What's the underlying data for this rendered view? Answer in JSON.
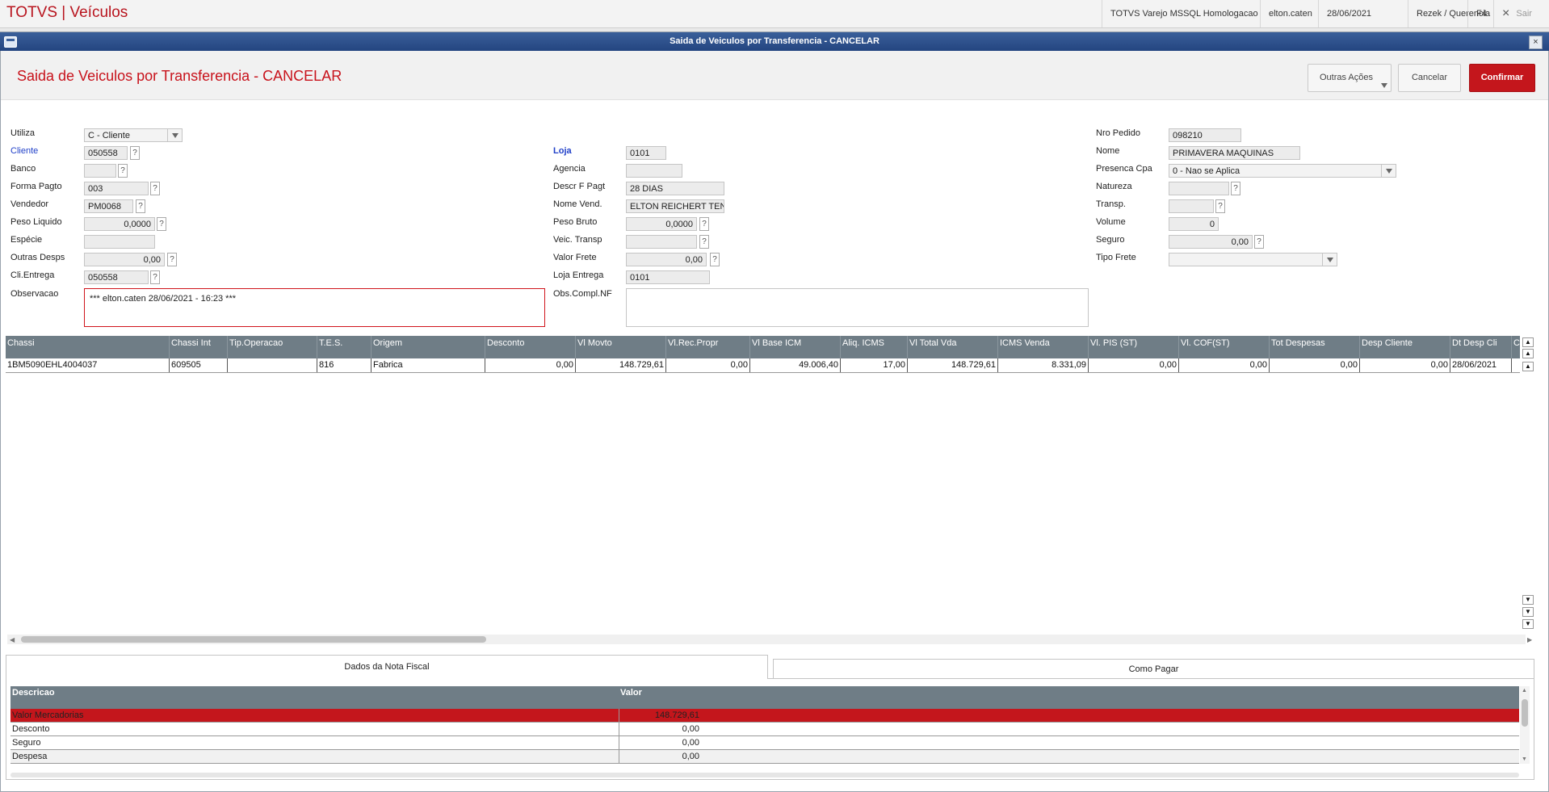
{
  "top": {
    "app_title": "TOTVS | Veículos",
    "environment": "TOTVS Varejo MSSQL Homologacao",
    "user": "elton.caten",
    "date": "28/06/2021",
    "branch": "Rezek / Querencia",
    "f4": "F4",
    "exit_label": "Sair",
    "exit_icon": "×"
  },
  "window": {
    "title": "Saida de Veiculos por Transferencia - CANCELAR",
    "close_icon": "×"
  },
  "header": {
    "title": "Saida de Veiculos por Transferencia - CANCELAR",
    "other_actions": "Outras Ações",
    "cancel": "Cancelar",
    "confirm": "Confirmar"
  },
  "form": {
    "utiliza_label": "Utiliza",
    "utiliza_value": "C - Cliente",
    "cliente_label": "Cliente",
    "cliente_value": "050558",
    "banco_label": "Banco",
    "banco_value": "",
    "forma_pagto_label": "Forma Pagto",
    "forma_pagto_value": "003",
    "vendedor_label": "Vendedor",
    "vendedor_value": "PM0068",
    "peso_liquido_label": "Peso Liquido",
    "peso_liquido_value": "0,0000",
    "especie_label": "Espécie",
    "especie_value": "",
    "outras_desps_label": "Outras Desps",
    "outras_desps_value": "0,00",
    "cli_entrega_label": "Cli.Entrega",
    "cli_entrega_value": "050558",
    "observacao_label": "Observacao",
    "observacao_value": "***  elton.caten  28/06/2021 - 16:23  ***",
    "loja_label": "Loja",
    "loja_value": "0101",
    "agencia_label": "Agencia",
    "agencia_value": "",
    "descr_f_pagt_label": "Descr F Pagt",
    "descr_f_pagt_value": "28 DIAS",
    "nome_vend_label": "Nome Vend.",
    "nome_vend_value": "ELTON REICHERT TEN C",
    "peso_bruto_label": "Peso Bruto",
    "peso_bruto_value": "0,0000",
    "veic_transp_label": "Veic. Transp",
    "veic_transp_value": "",
    "valor_frete_label": "Valor Frete",
    "valor_frete_value": "0,00",
    "loja_entrega_label": "Loja Entrega",
    "loja_entrega_value": "0101",
    "obs_compl_label": "Obs.Compl.NF",
    "obs_compl_value": "",
    "nro_pedido_label": "Nro Pedido",
    "nro_pedido_value": "098210",
    "nome_label": "Nome",
    "nome_value": "PRIMAVERA MAQUINAS",
    "presenca_cpa_label": "Presenca Cpa",
    "presenca_cpa_value": "0 - Nao se Aplica",
    "natureza_label": "Natureza",
    "natureza_value": "",
    "transp_label": "Transp.",
    "transp_value": "",
    "volume_label": "Volume",
    "volume_value": "0",
    "seguro_label": "Seguro",
    "seguro_value": "0,00",
    "tipo_frete_label": "Tipo Frete",
    "tipo_frete_value": "",
    "help_glyph": "?"
  },
  "grid": {
    "columns": [
      "Chassi",
      "Chassi Int",
      "Tip.Operacao",
      "T.E.S.",
      "Origem",
      "Desconto",
      "Vl Movto",
      "Vl.Rec.Propr",
      "Vl Base ICM",
      "Aliq. ICMS",
      "Vl Total Vda",
      "ICMS Venda",
      "Vl. PIS (ST)",
      "Vl. COF(ST)",
      "Tot Despesas",
      "Desp Cliente",
      "Dt Desp Cli",
      "C"
    ],
    "row": [
      "1BM5090EHL4004037",
      "609505",
      "",
      "816",
      "Fabrica",
      "0,00",
      "148.729,61",
      "0,00",
      "49.006,40",
      "17,00",
      "148.729,61",
      "8.331,09",
      "0,00",
      "0,00",
      "0,00",
      "0,00",
      "28/06/2021",
      ""
    ]
  },
  "tabs": {
    "nota_fiscal": "Dados da Nota Fiscal",
    "como_pagar": "Como Pagar"
  },
  "nf_table": {
    "col_desc": "Descricao",
    "col_valor": "Valor",
    "rows": [
      {
        "desc": "Valor Mercadorias",
        "valor": "148.729,61"
      },
      {
        "desc": "Desconto",
        "valor": "0,00"
      },
      {
        "desc": "Seguro",
        "valor": "0,00"
      },
      {
        "desc": "Despesa",
        "valor": "0,00"
      }
    ]
  },
  "colors": {
    "brand_red": "#c4161c",
    "header_gray": "#6f7d86",
    "selected_row": "#c4161c"
  }
}
